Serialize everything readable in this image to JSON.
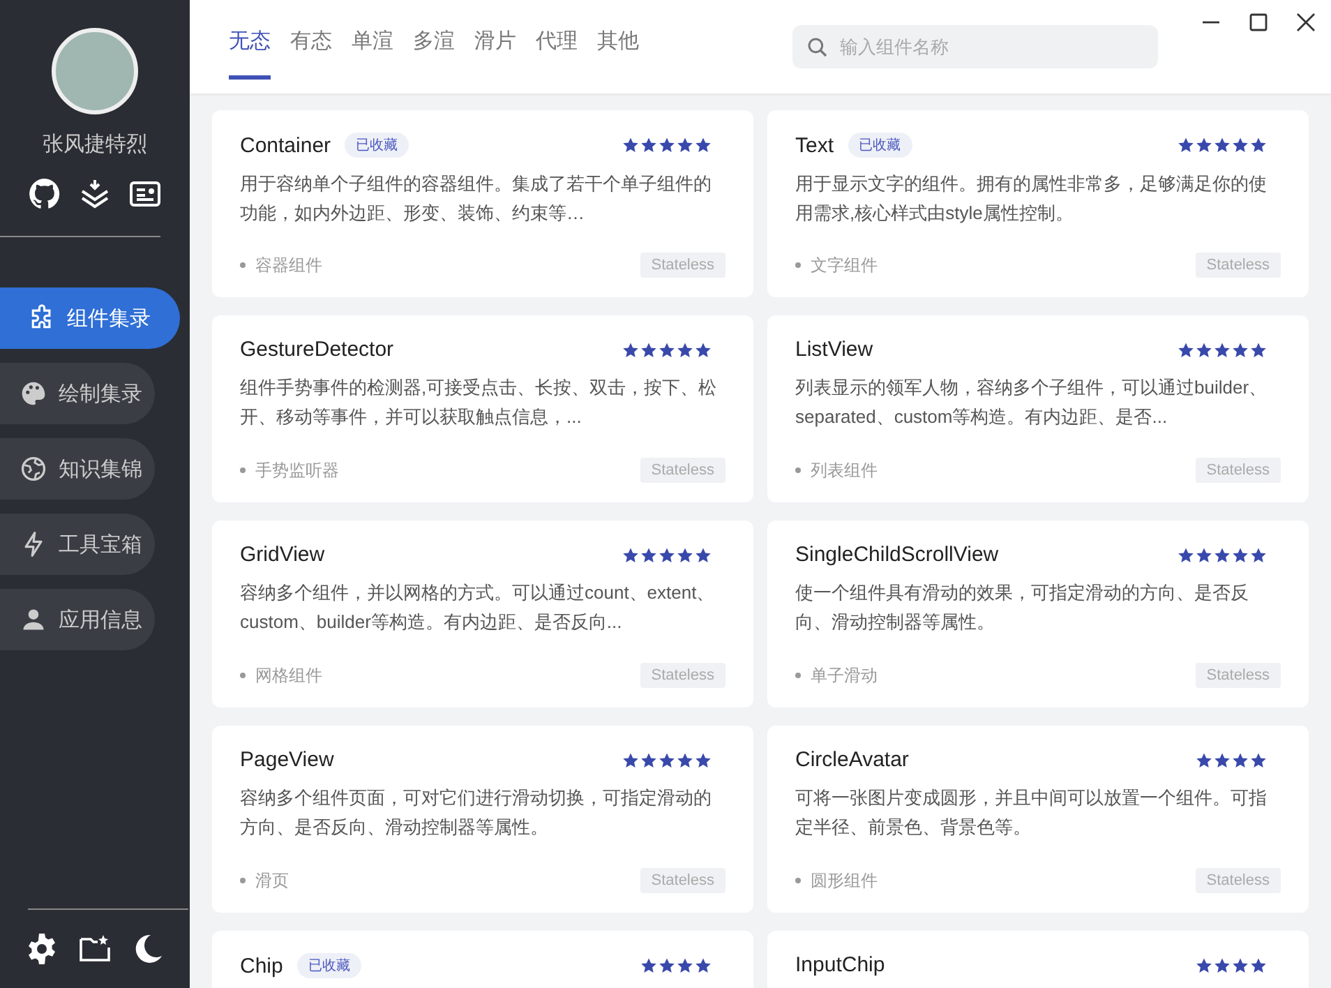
{
  "sidebar": {
    "user_name": "张风捷特烈",
    "nav_items": [
      {
        "label": "组件集录",
        "selected": true
      },
      {
        "label": "绘制集录",
        "selected": false
      },
      {
        "label": "知识集锦",
        "selected": false
      },
      {
        "label": "工具宝箱",
        "selected": false
      },
      {
        "label": "应用信息",
        "selected": false
      }
    ]
  },
  "tabs": [
    {
      "label": "无态",
      "selected": true
    },
    {
      "label": "有态",
      "selected": false
    },
    {
      "label": "单渲",
      "selected": false
    },
    {
      "label": "多渲",
      "selected": false
    },
    {
      "label": "滑片",
      "selected": false
    },
    {
      "label": "代理",
      "selected": false
    },
    {
      "label": "其他",
      "selected": false
    }
  ],
  "search": {
    "placeholder": "输入组件名称"
  },
  "cards": [
    {
      "title": "Container",
      "badge": "已收藏",
      "stars": 5,
      "description": "用于容纳单个子组件的容器组件。集成了若干个单子组件的功能，如内外边距、形变、装饰、约束等…",
      "category": "容器组件",
      "type": "Stateless"
    },
    {
      "title": "Text",
      "badge": "已收藏",
      "stars": 5,
      "description": "用于显示文字的组件。拥有的属性非常多，足够满足你的使用需求,核心样式由style属性控制。",
      "category": "文字组件",
      "type": "Stateless"
    },
    {
      "title": "GestureDetector",
      "stars": 5,
      "description": "组件手势事件的检测器,可接受点击、长按、双击，按下、松开、移动等事件，并可以获取触点信息，...",
      "category": "手势监听器",
      "type": "Stateless"
    },
    {
      "title": "ListView",
      "stars": 5,
      "description": "列表显示的领军人物，容纳多个子组件，可以通过builder、separated、custom等构造。有内边距、是否...",
      "category": "列表组件",
      "type": "Stateless"
    },
    {
      "title": "GridView",
      "stars": 5,
      "description": "容纳多个组件，并以网格的方式。可以通过count、extent、custom、builder等构造。有内边距、是否反向...",
      "category": "网格组件",
      "type": "Stateless"
    },
    {
      "title": "SingleChildScrollView",
      "stars": 5,
      "description": "使一个组件具有滑动的效果，可指定滑动的方向、是否反向、滑动控制器等属性。",
      "category": "单子滑动",
      "type": "Stateless"
    },
    {
      "title": "PageView",
      "stars": 5,
      "description": "容纳多个组件页面，可对它们进行滑动切换，可指定滑动的方向、是否反向、滑动控制器等属性。",
      "category": "滑页",
      "type": "Stateless"
    },
    {
      "title": "CircleAvatar",
      "stars": 4,
      "description": "可将一张图片变成圆形，并且中间可以放置一个组件。可指定半径、前景色、背景色等。",
      "category": "圆形组件",
      "type": "Stateless"
    },
    {
      "title": "Chip",
      "badge": "已收藏",
      "stars": 4
    },
    {
      "title": "InputChip",
      "stars": 4
    }
  ]
}
